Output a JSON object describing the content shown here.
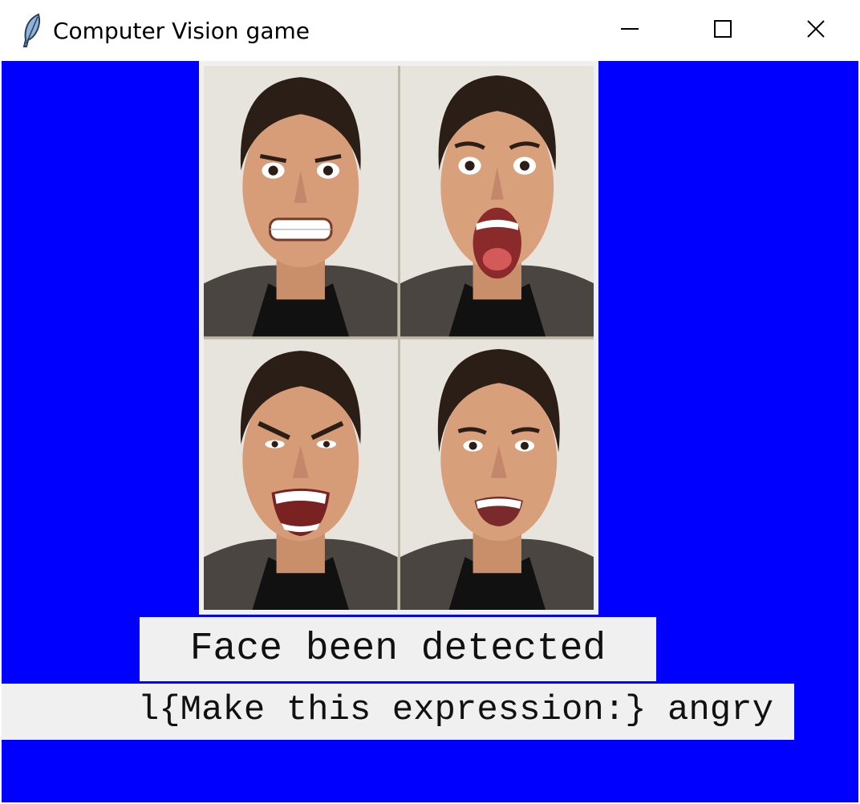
{
  "window": {
    "title": "Computer Vision game",
    "app_icon": "feather-icon",
    "controls": {
      "minimize": "minimize-icon",
      "maximize": "maximize-icon",
      "close": "close-icon"
    }
  },
  "canvas": {
    "background": "#0000ff"
  },
  "photo": {
    "description_icon": "face-expressions-photo",
    "panels": [
      {
        "icon": "face-grimace"
      },
      {
        "icon": "face-shock"
      },
      {
        "icon": "face-angry"
      },
      {
        "icon": "face-happy"
      }
    ]
  },
  "status": {
    "detected": "Face been detected",
    "instruction": "l{Make this expression:} angry"
  }
}
